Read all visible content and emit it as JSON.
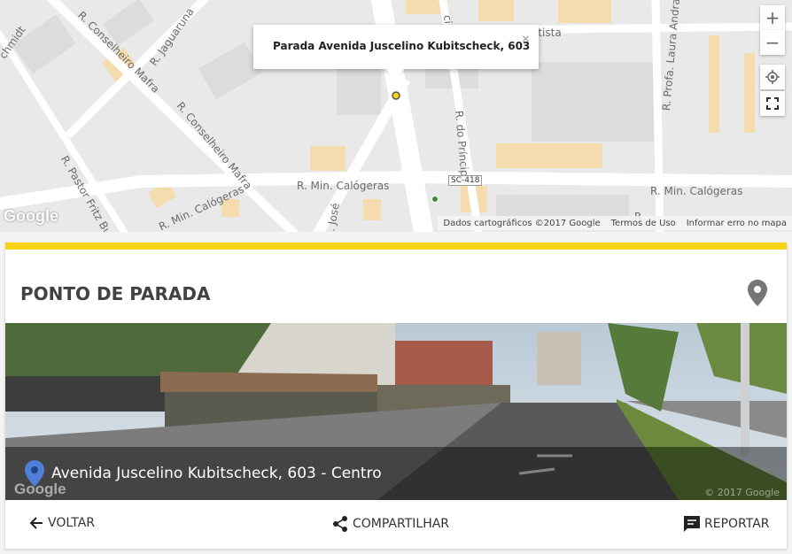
{
  "map": {
    "infowindow_title": "Parada Avenida Juscelino Kubitscheck, 603",
    "close_symbol": "×",
    "zoom_in": "+",
    "zoom_out": "−",
    "streets": {
      "schmidt": "chmidt",
      "conselheiro_mafra_top": "R. Conselheiro Mafra",
      "jaguaruna": "R. Jaguaruna",
      "conselheiro_mafra_mid": "R. Conselheiro Mafra",
      "principe_top": "cipe",
      "batista": "atista",
      "profa_laura": "R. Profa. Laura Andrade",
      "do_principe": "R. do Príncipe",
      "pastor_fritz": "R. Pastor Fritz Buhler",
      "calogeras_left": "R. Min. Calógeras",
      "calogeras_mid": "R. Min. Calógeras",
      "calogeras_right": "R. Min. Calógeras",
      "jose": "R. José",
      "sc418": "SC-418",
      "r_edge": "R"
    },
    "google_logo": "Google",
    "attribution": {
      "data": "Dados cartográficos ©2017 Google",
      "terms": "Termos de Uso",
      "report": "Informar erro no mapa"
    }
  },
  "card": {
    "accent_color": "#f7d417",
    "title": "PONTO DE PARADA",
    "address": "Avenida Juscelino Kubitscheck, 603 - Centro",
    "photo_logo": "Google",
    "photo_copyright": "© 2017 Google",
    "actions": {
      "back": "VOLTAR",
      "share": "COMPARTILHAR",
      "report": "REPORTAR"
    }
  },
  "icons": [
    "map-pin-icon",
    "location-pin-icon",
    "arrow-back-icon",
    "share-icon",
    "feedback-icon",
    "my-location-icon",
    "fullscreen-icon",
    "close-icon"
  ]
}
